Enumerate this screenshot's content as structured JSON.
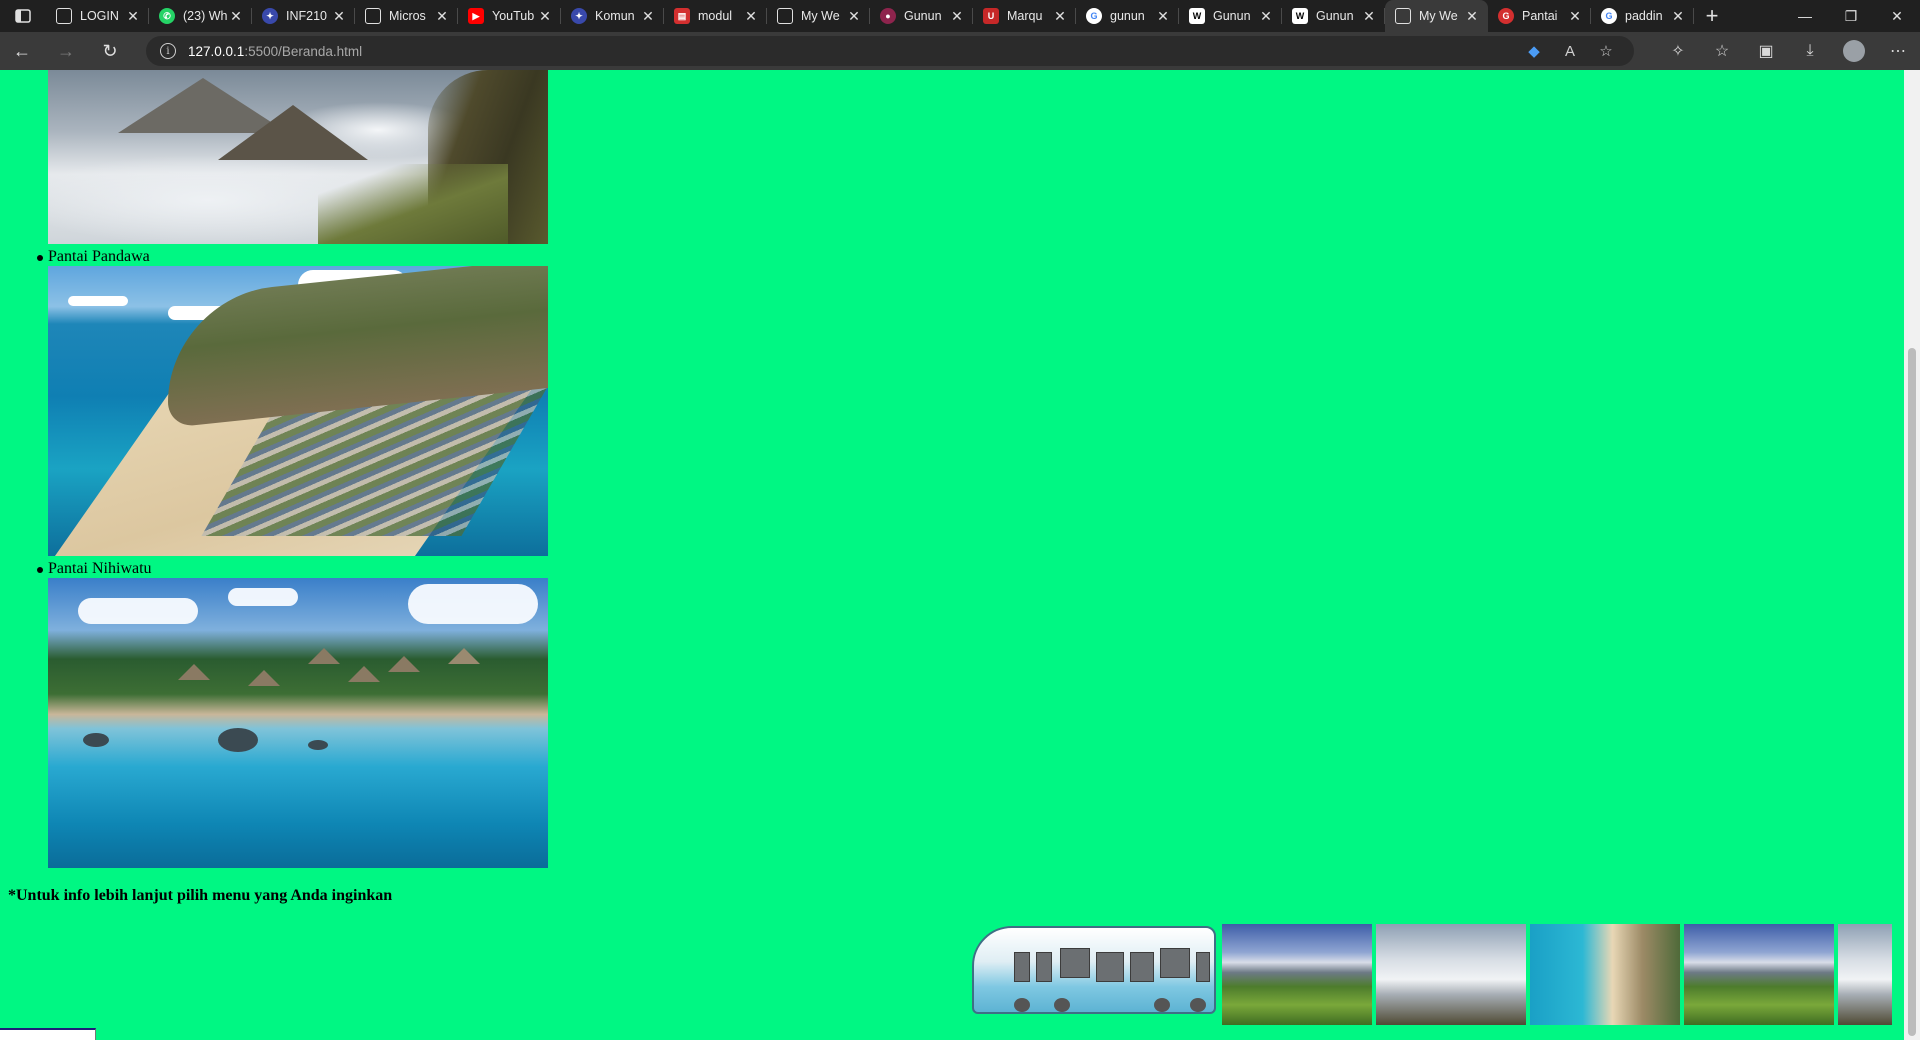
{
  "browser": {
    "tabs": [
      {
        "label": "LOGIN",
        "favicon": "page-icon",
        "color": "#5f6368"
      },
      {
        "label": "(23) Wh",
        "favicon": "whatsapp-icon",
        "color": "#25d366"
      },
      {
        "label": "INF210",
        "favicon": "app-icon",
        "color": "#3949ab"
      },
      {
        "label": "Micros",
        "favicon": "page-icon",
        "color": "#5f6368"
      },
      {
        "label": "YouTub",
        "favicon": "youtube-icon",
        "color": "#ff0000"
      },
      {
        "label": "Komun",
        "favicon": "app-icon",
        "color": "#3949ab"
      },
      {
        "label": "modul",
        "favicon": "pdf-icon",
        "color": "#d32f2f"
      },
      {
        "label": "My We",
        "favicon": "page-icon",
        "color": "#5f6368"
      },
      {
        "label": "Gunun",
        "favicon": "site-icon",
        "color": "#8e244d"
      },
      {
        "label": "Marqu",
        "favicon": "magnet-icon",
        "color": "#c62828"
      },
      {
        "label": "gunun",
        "favicon": "google-icon",
        "color": "#4285f4"
      },
      {
        "label": "Gunun",
        "favicon": "wikipedia-icon",
        "color": "#ffffff"
      },
      {
        "label": "Gunun",
        "favicon": "wikipedia-icon",
        "color": "#ffffff"
      },
      {
        "label": "My We",
        "favicon": "page-icon",
        "color": "#5f6368",
        "active": true
      },
      {
        "label": "Pantai",
        "favicon": "site-icon",
        "color": "#d32f2f"
      },
      {
        "label": "paddin",
        "favicon": "google-icon",
        "color": "#4285f4"
      }
    ],
    "url_host": "127.0.0.1",
    "url_path": ":5500/Beranda.html"
  },
  "page": {
    "items": [
      {
        "label": "Pantai Pandawa"
      },
      {
        "label": "Pantai Nihiwatu"
      }
    ],
    "footer_note": "*Untuk info lebih lanjut pilih menu yang Anda inginkan"
  },
  "colors": {
    "page_background": "#00f783",
    "chrome_dark": "#202020",
    "chrome_toolbar": "#3a3a3a"
  }
}
